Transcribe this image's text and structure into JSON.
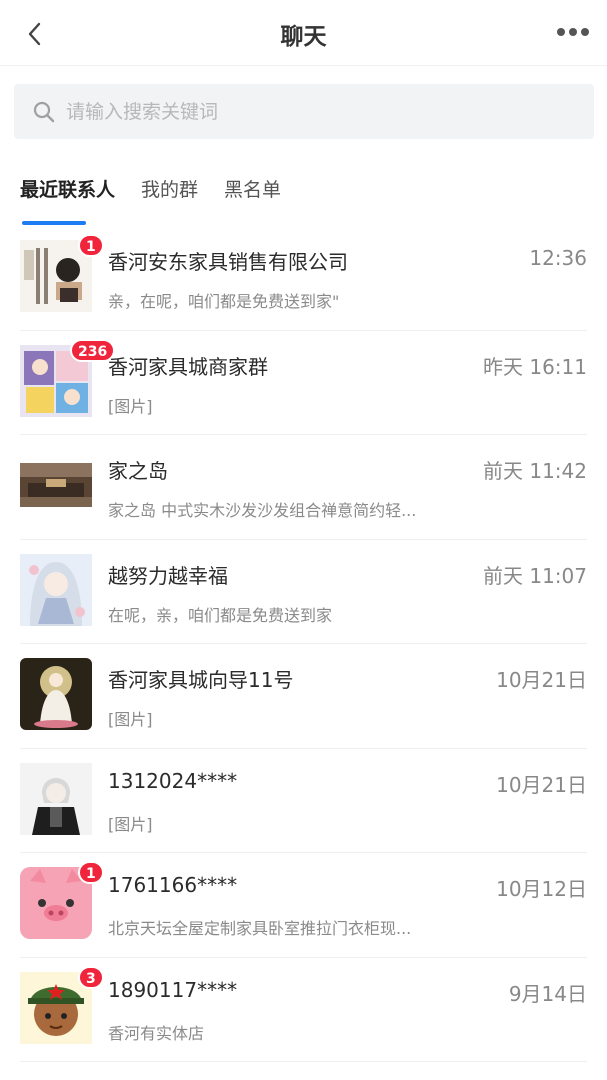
{
  "header": {
    "title": "聊天"
  },
  "search": {
    "placeholder": "请输入搜索关键词"
  },
  "tabs": [
    {
      "label": "最近联系人",
      "active": true
    },
    {
      "label": "我的群",
      "active": false
    },
    {
      "label": "黑名单",
      "active": false
    }
  ],
  "chats": [
    {
      "name": "香河安东家具销售有限公司",
      "time": "12:36",
      "preview": "亲，在呢，咱们都是免费送到家\"",
      "badge": "1",
      "avatar_icon": "calligraphy-avatar-icon"
    },
    {
      "name": "香河家具城商家群",
      "time": "昨天 16:11",
      "preview": "[图片]",
      "badge": "236",
      "avatar_icon": "anime-collage-avatar-icon"
    },
    {
      "name": "家之岛",
      "time": "前天 11:42",
      "preview": "家之岛 中式实木沙发沙发组合禅意简约轻...",
      "badge": "",
      "avatar_icon": "living-room-avatar-icon"
    },
    {
      "name": "越努力越幸福",
      "time": "前天 11:07",
      "preview": "在呢，亲，咱们都是免费送到家",
      "badge": "",
      "avatar_icon": "anime-girl-avatar-icon"
    },
    {
      "name": "香河家具城向导11号",
      "time": "10月21日",
      "preview": "[图片]",
      "badge": "",
      "avatar_icon": "guanyin-avatar-icon"
    },
    {
      "name": "1312024****",
      "time": "10月21日",
      "preview": "[图片]",
      "badge": "",
      "avatar_icon": "anime-boy-avatar-icon"
    },
    {
      "name": "1761166****",
      "time": "10月12日",
      "preview": "北京天坛全屋定制家具卧室推拉门衣柜现...",
      "badge": "1",
      "avatar_icon": "pig-avatar-icon"
    },
    {
      "name": "1890117****",
      "time": "9月14日",
      "preview": "香河有实体店",
      "badge": "3",
      "avatar_icon": "soldier-avatar-icon"
    }
  ],
  "colors": {
    "accent": "#1e7cf2",
    "badge": "#f0253c"
  }
}
